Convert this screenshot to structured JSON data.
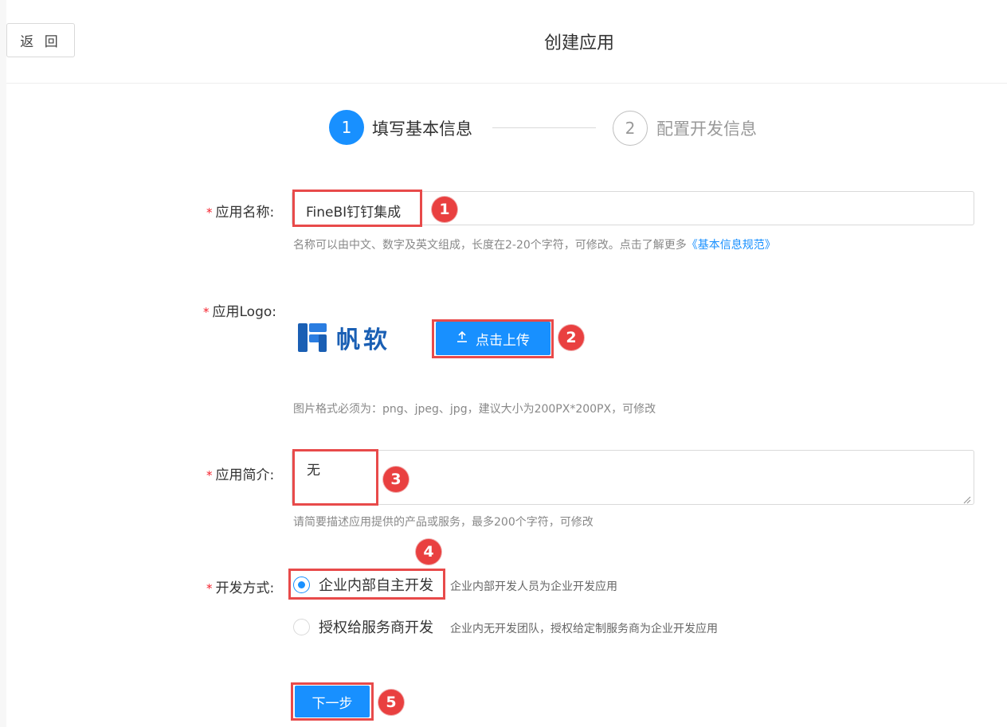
{
  "header": {
    "back_label": "返 回",
    "title": "创建应用"
  },
  "steps": [
    {
      "number": "1",
      "label": "填写基本信息",
      "status": "active"
    },
    {
      "number": "2",
      "label": "配置开发信息",
      "status": "pending"
    }
  ],
  "form": {
    "app_name": {
      "required_mark": "*",
      "label": "应用名称:",
      "value": "FineBI钉钉集成",
      "hint": "名称可以由中文、数字及英文组成，长度在2-20个字符，可修改。点击了解更多",
      "hint_link": "《基本信息规范》"
    },
    "app_logo": {
      "required_mark": "*",
      "label": "应用Logo:",
      "logo_text": "帆软",
      "upload_label": "点击上传",
      "hint": "图片格式必须为：png、jpeg、jpg，建议大小为200PX*200PX，可修改"
    },
    "app_intro": {
      "required_mark": "*",
      "label": "应用简介:",
      "value": "无",
      "hint": "请简要描述应用提供的产品或服务，最多200个字符，可修改"
    },
    "dev_mode": {
      "required_mark": "*",
      "label": "开发方式:",
      "options": [
        {
          "label": "企业内部自主开发",
          "desc": "企业内部开发人员为企业开发应用",
          "checked": true
        },
        {
          "label": "授权给服务商开发",
          "desc": "企业内无开发团队，授权给定制服务商为企业开发应用",
          "checked": false
        }
      ]
    },
    "next_label": "下一步"
  },
  "annotations": [
    "1",
    "2",
    "3",
    "4",
    "5"
  ],
  "colors": {
    "primary": "#1890ff",
    "annotation_red": "#e94040",
    "required": "#f5222d"
  }
}
